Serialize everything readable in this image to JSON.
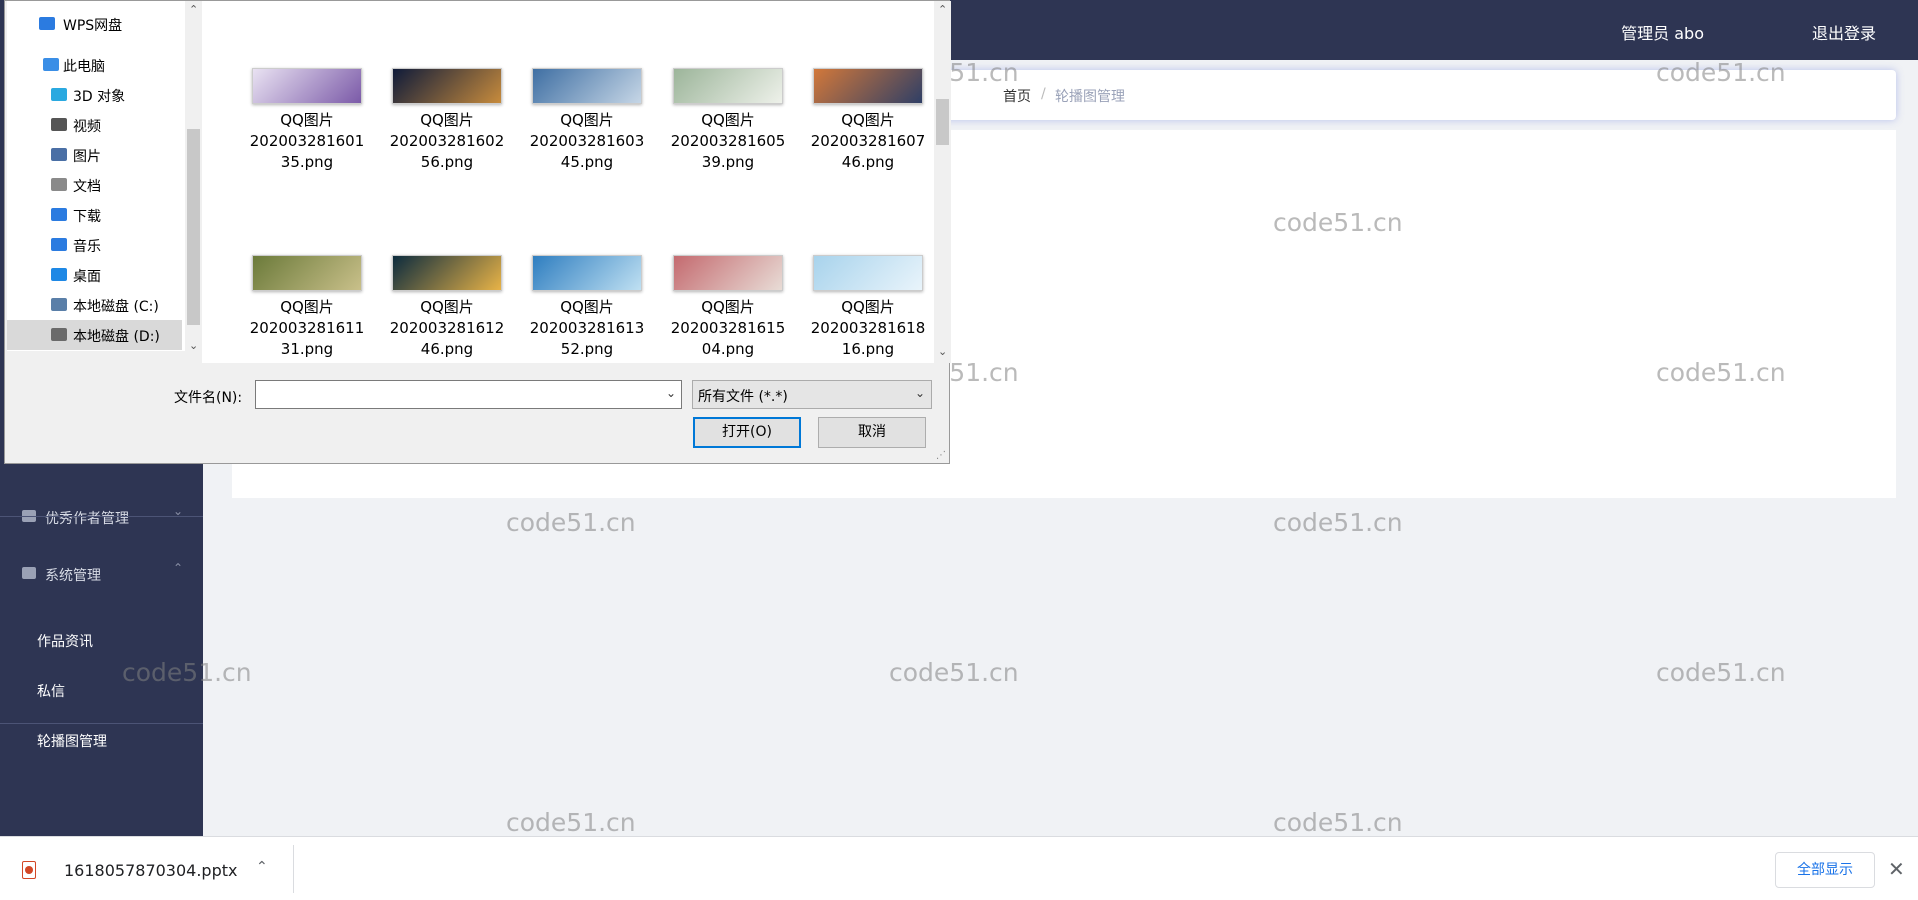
{
  "app": {
    "user_label": "管理员 abo",
    "logout_label": "退出登录",
    "breadcrumb": {
      "home": "首页",
      "separator": "/",
      "current": "轮播图管理"
    },
    "sidebar": {
      "groups": [
        {
          "label": "优秀作者管理",
          "arrow": "⌄"
        },
        {
          "label": "系统管理",
          "arrow": "⌃"
        }
      ],
      "items": [
        {
          "label": "作品资讯"
        },
        {
          "label": "私信"
        },
        {
          "label": "轮播图管理"
        }
      ]
    },
    "watermark_text": "code51.cn"
  },
  "dialog": {
    "nav_items": [
      {
        "label": "WPS网盘",
        "icon": "cloud-icon",
        "color": "#2b7be0"
      },
      {
        "label": "此电脑",
        "icon": "computer-icon",
        "color": "#3a8ee6"
      },
      {
        "label": "3D 对象",
        "icon": "3d-objects-icon",
        "color": "#2aa9e0"
      },
      {
        "label": "视频",
        "icon": "video-icon",
        "color": "#555555"
      },
      {
        "label": "图片",
        "icon": "pictures-icon",
        "color": "#4a6fa5"
      },
      {
        "label": "文档",
        "icon": "documents-icon",
        "color": "#8a8a8a"
      },
      {
        "label": "下载",
        "icon": "download-icon",
        "color": "#2b7be0"
      },
      {
        "label": "音乐",
        "icon": "music-icon",
        "color": "#2b7be0"
      },
      {
        "label": "桌面",
        "icon": "desktop-icon",
        "color": "#1e88e5"
      },
      {
        "label": "本地磁盘 (C:)",
        "icon": "drive-c-icon",
        "color": "#5a7fa8"
      },
      {
        "label": "本地磁盘 (D:)",
        "icon": "drive-d-icon",
        "color": "#6a6a6a"
      }
    ],
    "files": [
      {
        "lines": [
          "QQ图片",
          "202003281601",
          "35.png"
        ],
        "colors": [
          "#e9e2f2",
          "#7b5aa8"
        ]
      },
      {
        "lines": [
          "QQ图片",
          "202003281602",
          "56.png"
        ],
        "colors": [
          "#0f1b3a",
          "#c78b3c"
        ]
      },
      {
        "lines": [
          "QQ图片",
          "202003281603",
          "45.png"
        ],
        "colors": [
          "#3f6fa3",
          "#c6d6e6"
        ]
      },
      {
        "lines": [
          "QQ图片",
          "202003281605",
          "39.png"
        ],
        "colors": [
          "#9cb59a",
          "#eef1ea"
        ]
      },
      {
        "lines": [
          "QQ图片",
          "202003281607",
          "46.png"
        ],
        "colors": [
          "#d2783a",
          "#2f3f66"
        ]
      },
      {
        "lines": [
          "QQ图片",
          "202003281611",
          "31.png"
        ],
        "colors": [
          "#6b7a3a",
          "#c9c08a"
        ]
      },
      {
        "lines": [
          "QQ图片",
          "202003281612",
          "46.png"
        ],
        "colors": [
          "#0c2b3e",
          "#e8b347"
        ]
      },
      {
        "lines": [
          "QQ图片",
          "202003281613",
          "52.png"
        ],
        "colors": [
          "#2f7ec0",
          "#bfe0f2"
        ]
      },
      {
        "lines": [
          "QQ图片",
          "202003281615",
          "04.png"
        ],
        "colors": [
          "#c46a6f",
          "#e8dcd6"
        ]
      },
      {
        "lines": [
          "QQ图片",
          "202003281618",
          "16.png"
        ],
        "colors": [
          "#a8d3ec",
          "#e9f4fb"
        ]
      }
    ],
    "filename_label": "文件名(N):",
    "filename_value": "",
    "filetype_value": "所有文件 (*.*)",
    "open_label": "打开(O)",
    "cancel_label": "取消"
  },
  "downloads": {
    "file_name": "1618057870304.pptx",
    "caret": "⌃",
    "show_all_label": "全部显示",
    "close": "✕"
  }
}
